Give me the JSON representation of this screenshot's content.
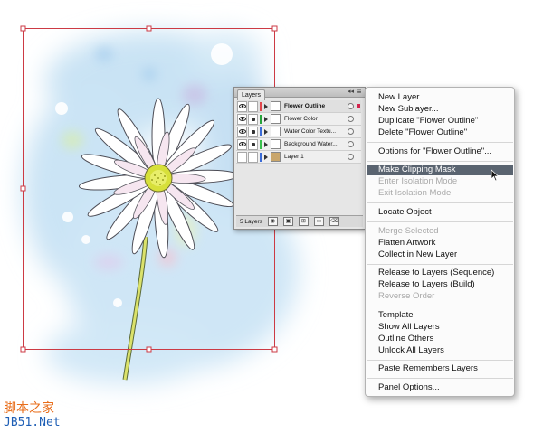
{
  "layers_panel": {
    "tab_label": "Layers",
    "layers": [
      {
        "name": "Flower Outline",
        "color": "#e0454a",
        "selected": true,
        "locked": false
      },
      {
        "name": "Flower Color",
        "color": "#27a43a",
        "selected": false,
        "locked": true
      },
      {
        "name": "Water Color Textu...",
        "color": "#3b6bd6",
        "selected": false,
        "locked": true
      },
      {
        "name": "Background Water...",
        "color": "#39c04d",
        "selected": false,
        "locked": true
      },
      {
        "name": "Layer 1",
        "color": "#3b6bd6",
        "selected": false,
        "locked": false
      }
    ],
    "layer_count": "5 Layers"
  },
  "context_menu": {
    "items": [
      {
        "label": "New Layer...",
        "enabled": true
      },
      {
        "label": "New Sublayer...",
        "enabled": true
      },
      {
        "label": "Duplicate \"Flower Outline\"",
        "enabled": true
      },
      {
        "label": "Delete \"Flower Outline\"",
        "enabled": true
      },
      {
        "label": "Options for \"Flower Outline\"...",
        "enabled": true
      },
      {
        "label": "Make Clipping Mask",
        "enabled": true,
        "highlighted": true
      },
      {
        "label": "Enter Isolation Mode",
        "enabled": false
      },
      {
        "label": "Exit Isolation Mode",
        "enabled": false
      },
      {
        "label": "Locate Object",
        "enabled": true
      },
      {
        "label": "Merge Selected",
        "enabled": false
      },
      {
        "label": "Flatten Artwork",
        "enabled": true
      },
      {
        "label": "Collect in New Layer",
        "enabled": true
      },
      {
        "label": "Release to Layers (Sequence)",
        "enabled": true
      },
      {
        "label": "Release to Layers (Build)",
        "enabled": true
      },
      {
        "label": "Reverse Order",
        "enabled": false
      },
      {
        "label": "Template",
        "enabled": true
      },
      {
        "label": "Show All Layers",
        "enabled": true
      },
      {
        "label": "Outline Others",
        "enabled": true
      },
      {
        "label": "Unlock All Layers",
        "enabled": true
      },
      {
        "label": "Paste Remembers Layers",
        "enabled": true
      },
      {
        "label": "Panel Options...",
        "enabled": true
      }
    ]
  },
  "watermark": {
    "cn": "脚本之家",
    "url": "JB51.Net"
  },
  "colors": {
    "selection_box": "#cc3a44",
    "menu_highlight": "#5a6470",
    "watercolor": "#b8d8ef",
    "flower_center": "#d7e03a"
  },
  "icons": [
    "eye-icon",
    "lock-icon",
    "disclosure-triangle-icon",
    "target-circle-icon",
    "panel-menu-icon",
    "new-layer-icon",
    "trash-icon",
    "arrow-cursor-icon"
  ]
}
